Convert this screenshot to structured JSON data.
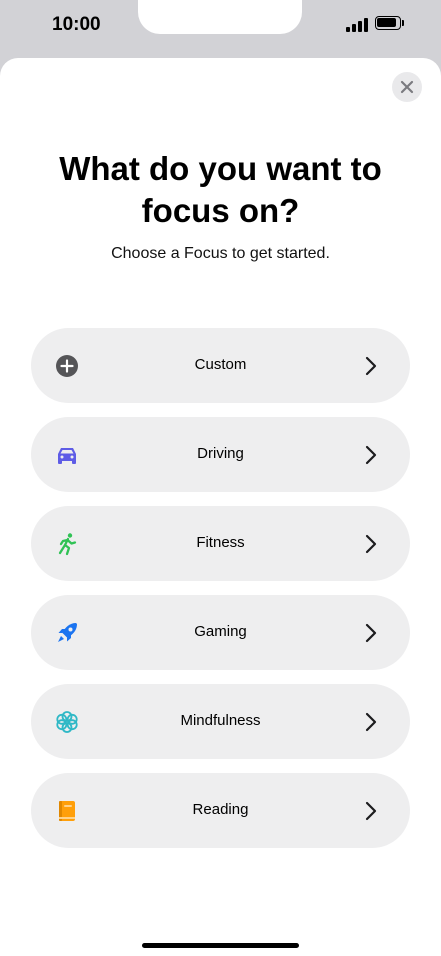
{
  "status_bar": {
    "time": "10:00"
  },
  "sheet": {
    "title_line1": "What do you want to",
    "title_line2": "focus on?",
    "subtitle": "Choose a Focus to get started."
  },
  "focus_options": [
    {
      "label": "Custom",
      "icon": "plus-circle-icon",
      "color": "#555558"
    },
    {
      "label": "Driving",
      "icon": "car-icon",
      "color": "#5e5ce6"
    },
    {
      "label": "Fitness",
      "icon": "running-icon",
      "color": "#30c255"
    },
    {
      "label": "Gaming",
      "icon": "rocket-icon",
      "color": "#1b74f0"
    },
    {
      "label": "Mindfulness",
      "icon": "flower-icon",
      "color": "#2fb8c6"
    },
    {
      "label": "Reading",
      "icon": "book-icon",
      "color": "#ff9f0a"
    }
  ]
}
